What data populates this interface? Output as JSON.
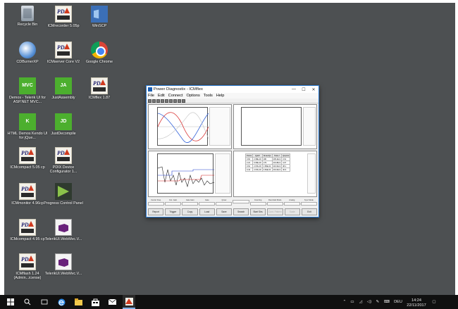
{
  "desktop_icons": [
    {
      "label": "Recycle Bin",
      "icon": "recycle-bin-icon"
    },
    {
      "label": "ICMrecorder 5.05p",
      "icon": "pd-icm-icon"
    },
    {
      "label": "WinSCP",
      "icon": "winscp-icon"
    },
    {
      "label": "CDBurnerXP",
      "icon": "cdburnerxp-icon"
    },
    {
      "label": "ICMserver Core V2",
      "icon": "pd-icm-icon"
    },
    {
      "label": "Google Chrome",
      "icon": "chrome-icon"
    },
    {
      "label": "Demos - Telerik UI for ASP.NET MVC...",
      "icon": "mvc-icon",
      "badge": "MVC"
    },
    {
      "label": "JustAssembly",
      "icon": "justassembly-icon",
      "badge": "JA"
    },
    {
      "label": "ICMflex 1.87",
      "icon": "pd-icm-icon"
    },
    {
      "label": "HTML Demos Kendo UI for jQue...",
      "icon": "kendo-icon",
      "badge": "K"
    },
    {
      "label": "JustDecompile",
      "icon": "justdecompile-icon",
      "badge": "JD"
    },
    {
      "label": "ICMcompact 5.05 cp",
      "icon": "pd-icm-icon"
    },
    {
      "label": "PDIX Device Configurator 1...",
      "icon": "pd-icm-icon"
    },
    {
      "label": "ICMmonitor 4.96cp",
      "icon": "pd-icm-icon"
    },
    {
      "label": "Progress Control Panel",
      "icon": "progress-icon"
    },
    {
      "label": "ICMcompact 4.95 cp",
      "icon": "pd-icm-icon"
    },
    {
      "label": "TelerikUI.WebMvc.V...",
      "icon": "vs-project-icon"
    },
    {
      "label": "ICMflash 1.24 (Admin...icense)",
      "icon": "pd-icm-icon"
    },
    {
      "label": "TelerikUI.WebMvc.V...",
      "icon": "vs-project-icon"
    }
  ],
  "window": {
    "title": "Power Diagnostix - ICMflex",
    "minimize": "—",
    "maximize": "☐",
    "close": "✕",
    "menu": [
      "File",
      "Edit",
      "Connect",
      "Options",
      "Tools",
      "Help"
    ],
    "status_labels": [
      "Center Freq.",
      "Inst. Gain",
      "Gate Gain",
      "Gate",
      "Qmax",
      "",
      "Counting",
      "Recorded Mode",
      "Analog",
      "Sync Mode"
    ],
    "status_values": [
      "",
      "",
      "",
      "",
      "",
      "",
      "",
      "",
      "",
      ""
    ],
    "buttons": [
      "Report",
      "Trigger",
      "Copy",
      "Load",
      "Save",
      "Search",
      "Start Sim.",
      "Cont. Pattern",
      "Scale",
      "Exit"
    ],
    "disabled_buttons": [
      7,
      8
    ],
    "table_header": [
      "Points",
      "Qpk/h",
      "Nmax/Qs",
      "N/sk+f",
      "Qs/pC/s"
    ],
    "table_rows": [
      [
        "0.84",
        "2.98E-03",
        "180",
        "405.4E-9",
        "3.61"
      ],
      [
        "2.22",
        "6.96E-03",
        "179",
        "431.8E-9",
        "4.07"
      ],
      [
        "0.62",
        "2.97E-03",
        "1.58E-04",
        "416.0E-9",
        "38.1"
      ],
      [
        "0.43",
        "2.97E-03",
        "4.84E-04",
        "401.0E-9",
        "46.6"
      ]
    ]
  },
  "taskbar": {
    "apps": [
      "start-icon",
      "search-icon",
      "task-view-icon",
      "edge-icon",
      "file-explorer-icon",
      "store-icon",
      "mail-icon",
      "icmflex-icon"
    ],
    "tray_lang": "DEU",
    "time": "14:24",
    "date": "22/11/2017"
  }
}
